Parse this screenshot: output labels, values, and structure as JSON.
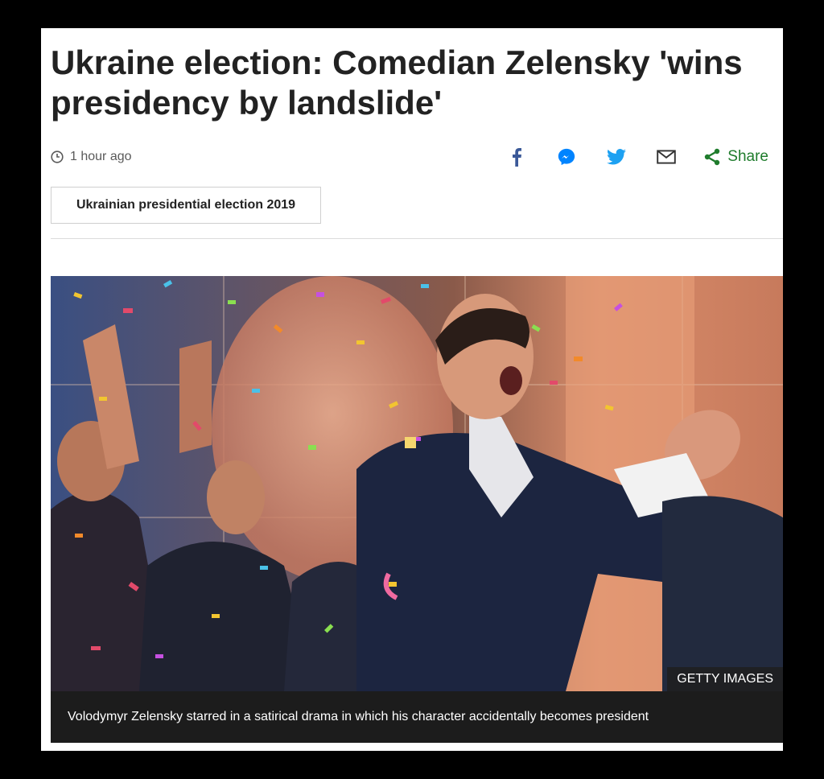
{
  "article": {
    "headline": "Ukraine election: Comedian Zelensky 'wins presidency by landslide'",
    "timestamp": "1 hour ago",
    "topic_tag": "Ukrainian presidential election 2019"
  },
  "share": {
    "icons": [
      "facebook-icon",
      "messenger-icon",
      "twitter-icon",
      "email-icon"
    ],
    "share_label": "Share"
  },
  "image": {
    "credit": "GETTY IMAGES",
    "caption": "Volodymyr Zelensky starred in a satirical drama in which his character accidentally becomes president"
  },
  "colors": {
    "facebook": "#3b5998",
    "messenger": "#0084ff",
    "twitter": "#1da1f2",
    "share_green": "#1f7c2c"
  }
}
